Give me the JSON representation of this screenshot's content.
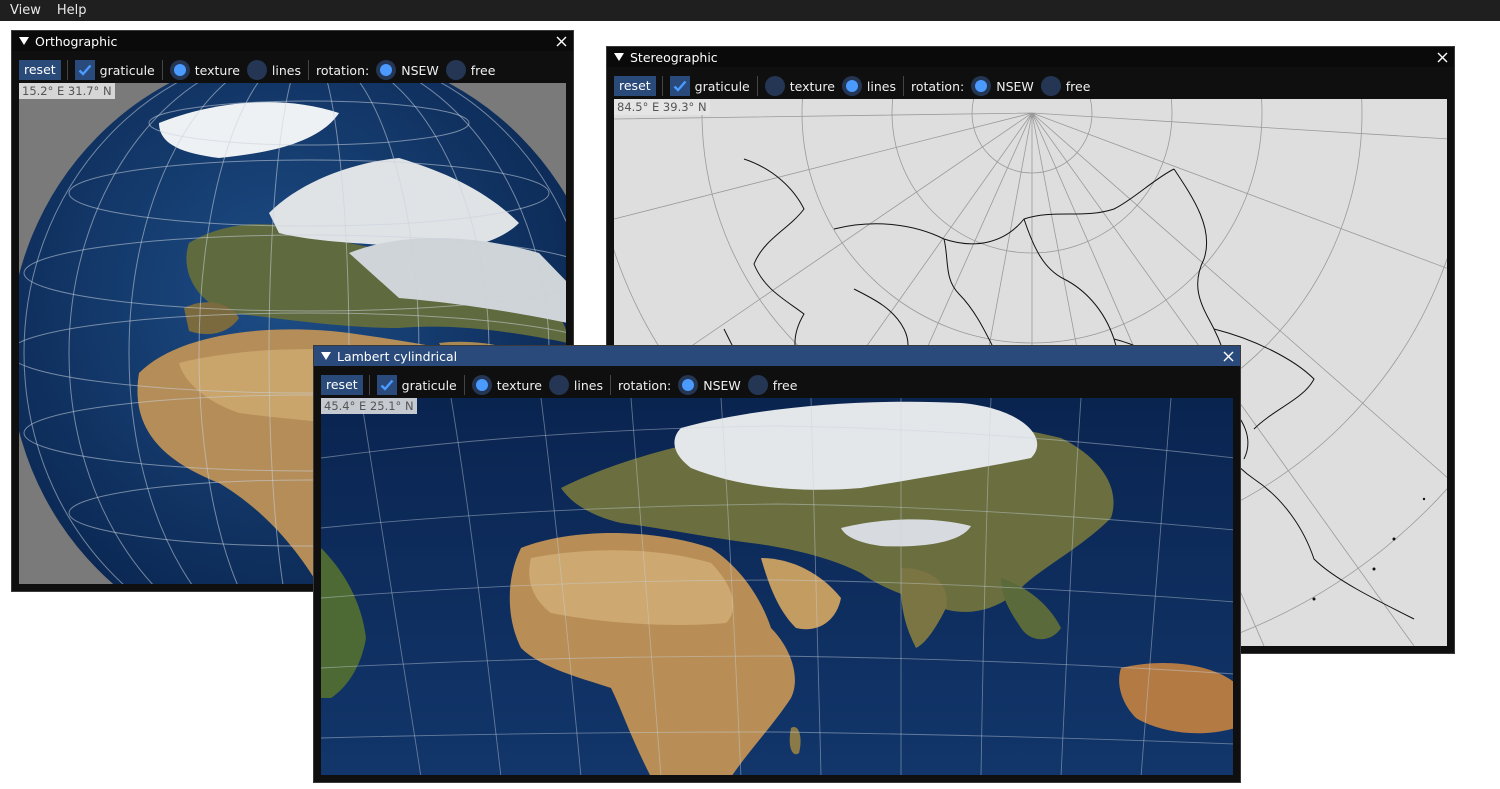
{
  "menubar": {
    "items": [
      "View",
      "Help"
    ]
  },
  "windows": {
    "ortho": {
      "title": "Orthographic",
      "toolbar": {
        "reset": "reset",
        "graticule": "graticule",
        "texture": "texture",
        "lines": "lines",
        "rotation": "rotation:",
        "nsew": "NSEW",
        "free": "free"
      },
      "graticule_on": true,
      "mode": "texture",
      "rotation_mode": "NSEW",
      "coord": "15.2° E 31.7° N"
    },
    "stereo": {
      "title": "Stereographic",
      "toolbar": {
        "reset": "reset",
        "graticule": "graticule",
        "texture": "texture",
        "lines": "lines",
        "rotation": "rotation:",
        "nsew": "NSEW",
        "free": "free"
      },
      "graticule_on": true,
      "mode": "lines",
      "rotation_mode": "NSEW",
      "coord": "84.5° E 39.3° N"
    },
    "lambert": {
      "title": "Lambert cylindrical",
      "toolbar": {
        "reset": "reset",
        "graticule": "graticule",
        "texture": "texture",
        "lines": "lines",
        "rotation": "rotation:",
        "nsew": "NSEW",
        "free": "free"
      },
      "graticule_on": true,
      "mode": "texture",
      "rotation_mode": "NSEW",
      "coord": "45.4° E 25.1° N"
    }
  },
  "colors": {
    "accent": "#4a9aff",
    "active_title": "#294a7a",
    "button": "#2a4a7a",
    "ocean": "#0e2a55",
    "land": "#b08a55",
    "snow": "#e6eaee",
    "map_bg": "#dedede"
  }
}
